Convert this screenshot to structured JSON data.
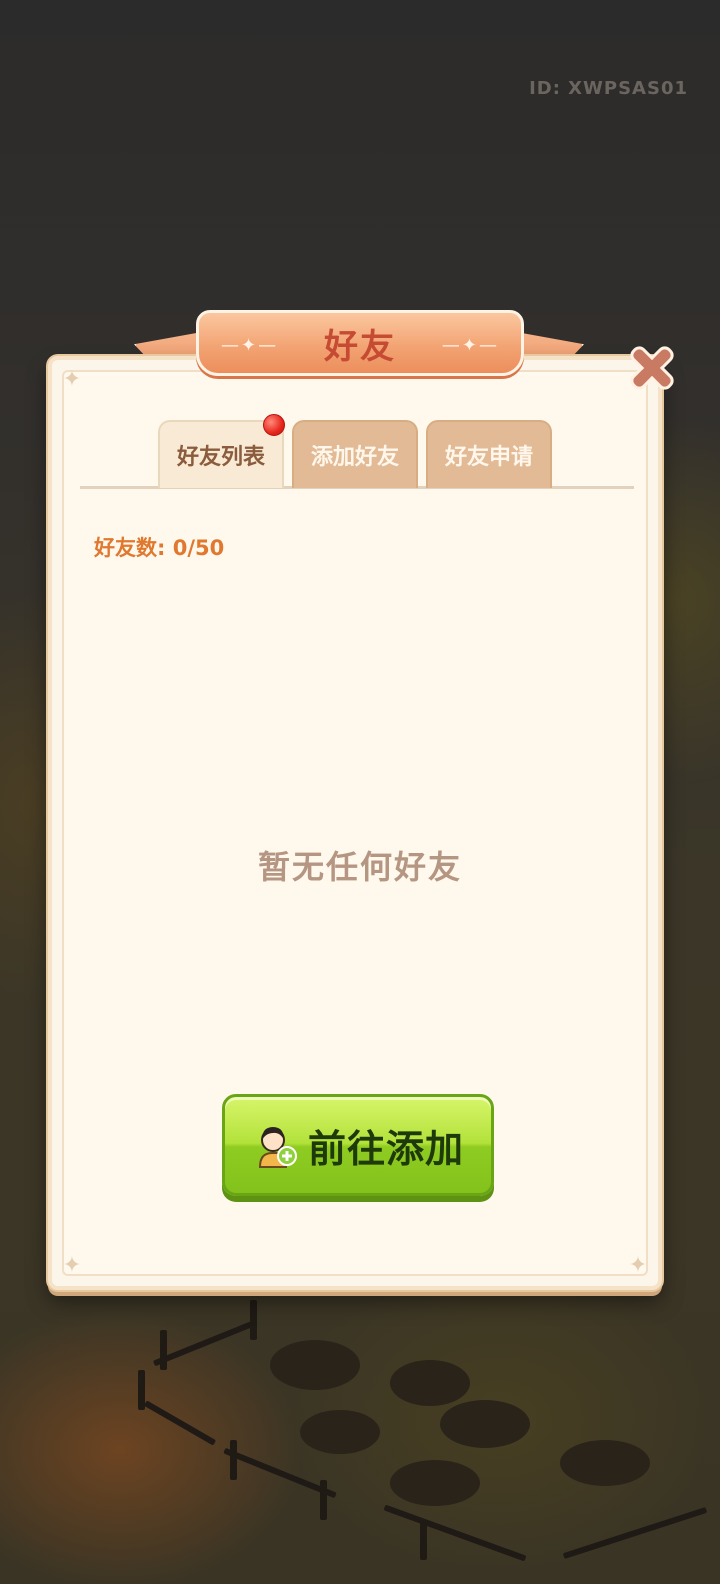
{
  "user_id": "ID: XWPSAS01",
  "dialog": {
    "title": "好友",
    "close_icon": "close-icon"
  },
  "tabs": [
    {
      "label": "好友列表",
      "active": true,
      "has_badge": true
    },
    {
      "label": "添加好友",
      "active": false,
      "has_badge": false
    },
    {
      "label": "好友申请",
      "active": false,
      "has_badge": false
    }
  ],
  "friend_count": "好友数: 0/50",
  "empty_message": "暂无任何好友",
  "action_button": {
    "label": "前往添加",
    "icon": "add-friend-icon"
  },
  "colors": {
    "accent_orange": "#e0792f",
    "title_red": "#c54b33",
    "button_green": "#a6dc33",
    "badge_red": "#e8261c"
  }
}
